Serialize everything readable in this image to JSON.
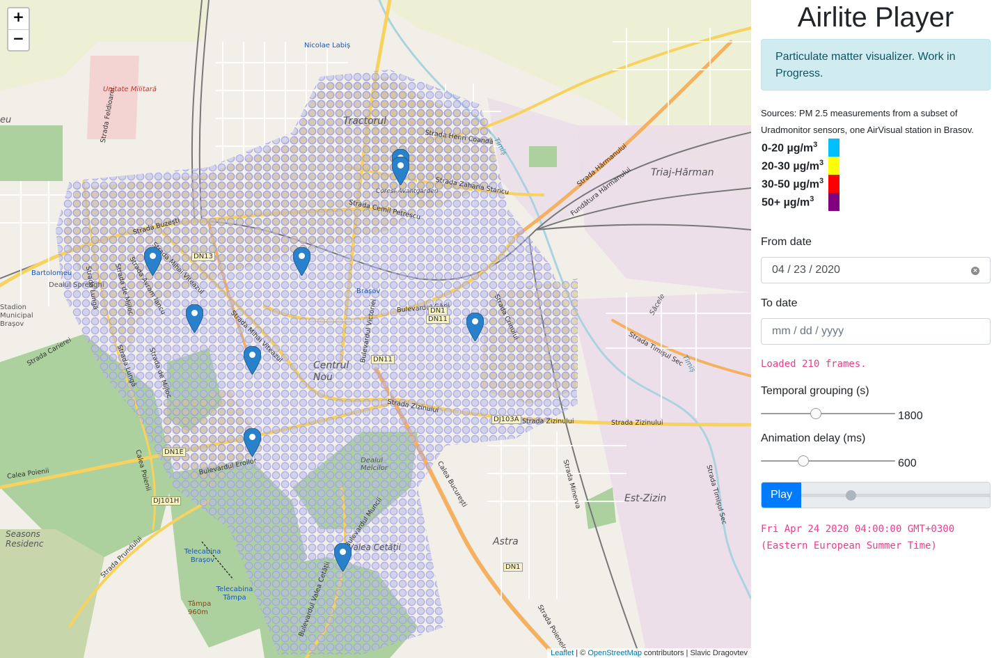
{
  "map": {
    "zoom_in": "+",
    "zoom_out": "−",
    "attribution": {
      "leaflet": "Leaflet",
      "sep1": " | © ",
      "osm": "OpenStreetMap",
      "rest": " contributors | Slavic Dragovtev"
    },
    "labels": {
      "nicolae_labis": "Nicolae Labiș",
      "unitate_militara": "Unitate Militară",
      "tractorul": "Tractorul",
      "coresi": "Coresi-Avantgarden",
      "triaj_harman": "Triaj-Hărman",
      "bartolomeu": "Bartolomeu",
      "dealul_sprenghi": "Dealul Sprenghi",
      "stadion": "Stadion Municipal Brașov",
      "brasov": "Brașov",
      "centrul_nou": "Centrul Nou",
      "dealul_melcilor": "Dealul Melcilor",
      "est_zizin": "Est-Zizin",
      "astra": "Astra",
      "seasons": "Seasons Residenc",
      "telecabina_brasov": "Telecabina Brașov",
      "telecabina_tampa": "Telecabina Tâmpa",
      "tampa": "Tâmpa 960m",
      "valea_cetatii": "Valea Cetății",
      "eu": "eu",
      "strada_buzesti": "Strada Buzești",
      "strada_zaharia_stancu": "Strada Zaharia Stancu",
      "strada_henri_coanda": "Strada Henri Coandă",
      "strada_cernit_petrescu": "Strada Cemil Petrescu",
      "strada_harmanului": "Strada Hărmanului",
      "fundatura_harmanului": "Fundătura Hărmanului",
      "bulevardul_garii": "Bulevardul Gării",
      "strada_zizinului": "Strada Zizinului",
      "calea_bucuresti": "Calea București",
      "bulevardul_eroilor": "Bulevardul Eroilor",
      "strada_timisul_sec": "Strada Timișul Sec",
      "strada_mihai_viteazul": "Strada Mihai Viteazul",
      "strada_lunga": "Strada Lungă",
      "strada_de_mijloc": "Strada de Mijloc",
      "bulevardul_victoriei": "Bulevardul Victoriei",
      "strada_carierei": "Strada Carierei",
      "calea_poienii": "Calea Poienii",
      "strada_prundului": "Strada Prundului",
      "bulevardul_muncii": "Bulevardul Muncii",
      "bulevardul_valea_cetatii": "Bulevardul Valea Cetății",
      "strada_minerva": "Strada Minerva",
      "strada_poienelor": "Strada Poienelor",
      "strada_crinului": "Strada Crinului",
      "strada_feldioarei": "Strada Feldioarei",
      "strada_avram_iancu": "Strada Avram Iancu",
      "timis": "Timiș",
      "sacele": "Săcele",
      "dn13": "DN13",
      "dn1": "DN1",
      "dn11": "DN11",
      "dn1e": "DN1E",
      "dj101h": "DJ101H",
      "dj103a": "DJ103A",
      "dn1_s": "DN1"
    }
  },
  "sidebar": {
    "title": "Airlite Player",
    "alert": "Particulate matter visualizer. Work in Progress.",
    "sources": "Sources: PM 2.5 measurements from a subset of Uradmonitor sensors, one AirVisual station in Brasov.",
    "legend": [
      {
        "label": "0-20 µg/m",
        "sup": "3",
        "color": "#00bfff"
      },
      {
        "label": "20-30 µg/m",
        "sup": "3",
        "color": "#ffff00"
      },
      {
        "label": "30-50 µg/m",
        "sup": "3",
        "color": "#ff0000"
      },
      {
        "label": "50+ µg/m",
        "sup": "3",
        "color": "#800080"
      }
    ],
    "from_date": {
      "label": "From date",
      "mm": "04",
      "dd": "23",
      "yyyy": "2020",
      "sep": "/"
    },
    "to_date": {
      "label": "To date",
      "placeholder": "mm / dd / yyyy"
    },
    "status": "Loaded 210 frames.",
    "temporal_grouping": {
      "label": "Temporal grouping (s)",
      "value": "1800",
      "fraction": 0.4
    },
    "animation_delay": {
      "label": "Animation delay (ms)",
      "value": "600",
      "fraction": 0.3
    },
    "play_label": "Play",
    "scrubber_fraction": 0.25,
    "timestamp_line1": "Fri Apr 24 2020 04:00:00 GMT+0300",
    "timestamp_line2": "(Eastern European Summer Time)"
  }
}
